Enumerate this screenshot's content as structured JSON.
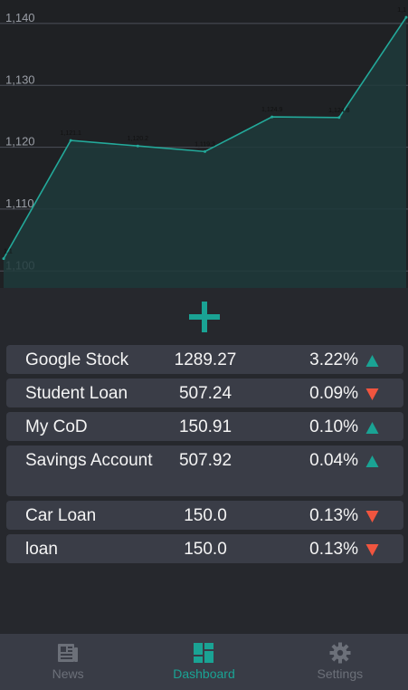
{
  "colors": {
    "accent": "#1aa394",
    "up": "#1aa394",
    "down": "#f0553f",
    "line": "#23a99a",
    "fill": "#1f3a3b"
  },
  "chart_data": {
    "type": "area",
    "x": [
      0,
      1,
      2,
      3,
      4,
      5,
      6
    ],
    "values": [
      1102,
      1121.1,
      1120.2,
      1119.3,
      1124.9,
      1124.8,
      1141
    ],
    "point_labels": [
      "1,1",
      "1,121.1",
      "1,120.2",
      "1,119.3",
      "1,124.9",
      "1,124.8",
      "1,1"
    ],
    "y_ticks": [
      "1,100",
      "1,110",
      "1,120",
      "1,130",
      "1,140"
    ],
    "y_tick_values": [
      1100,
      1110,
      1120,
      1130,
      1140
    ],
    "ylim": [
      1095.5,
      1143.5
    ],
    "grid": true
  },
  "add_button": {
    "icon": "plus-icon"
  },
  "items": [
    {
      "name": "Google Stock",
      "value": "1289.27",
      "pct": "3.22%",
      "dir": "up"
    },
    {
      "name": "Student Loan",
      "value": "507.24",
      "pct": "0.09%",
      "dir": "down"
    },
    {
      "name": "My CoD",
      "value": "150.91",
      "pct": "0.10%",
      "dir": "up"
    },
    {
      "name": "Savings Account",
      "value": "507.92",
      "pct": "0.04%",
      "dir": "up"
    },
    {
      "name": "Car Loan",
      "value": "150.0",
      "pct": "0.13%",
      "dir": "down"
    },
    {
      "name": "loan",
      "value": "150.0",
      "pct": "0.13%",
      "dir": "down"
    }
  ],
  "nav": {
    "news": "News",
    "dashboard": "Dashboard",
    "settings": "Settings"
  }
}
